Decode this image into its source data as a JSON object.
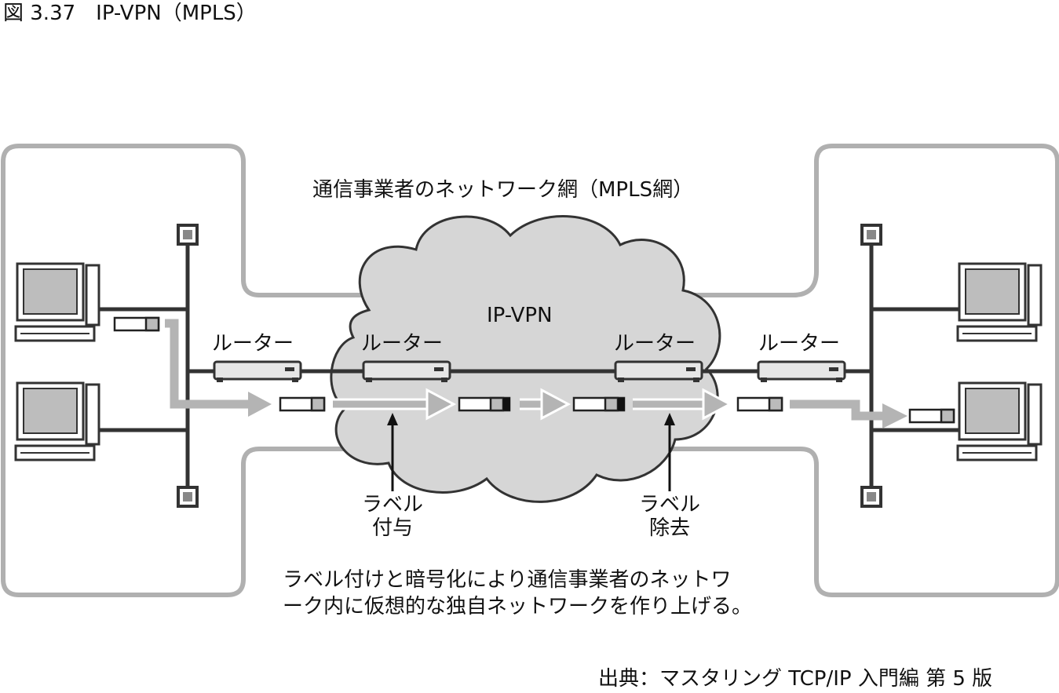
{
  "figure": {
    "title": "図 3.37　IP-VPN（MPLS）",
    "carrier_network_label": "通信事業者のネットワーク網（MPLS網）",
    "ipvpn_label": "IP-VPN",
    "router_labels": [
      "ルーター",
      "ルーター",
      "ルーター",
      "ルーター"
    ],
    "label_add": [
      "ラベル",
      "付与"
    ],
    "label_remove": [
      "ラベル",
      "除去"
    ],
    "caption_lines": [
      "ラベル付けと暗号化により通信事業者のネットワ",
      "ーク内に仮想的な独自ネットワークを作り上げる。"
    ],
    "source": "出典：マスタリング TCP/IP 入門編 第 5 版"
  },
  "colors": {
    "line": "#333333",
    "boundary": "#b0b0b0",
    "cloud_fill": "#d6d6d6",
    "arrow": "#b4b4b4"
  }
}
